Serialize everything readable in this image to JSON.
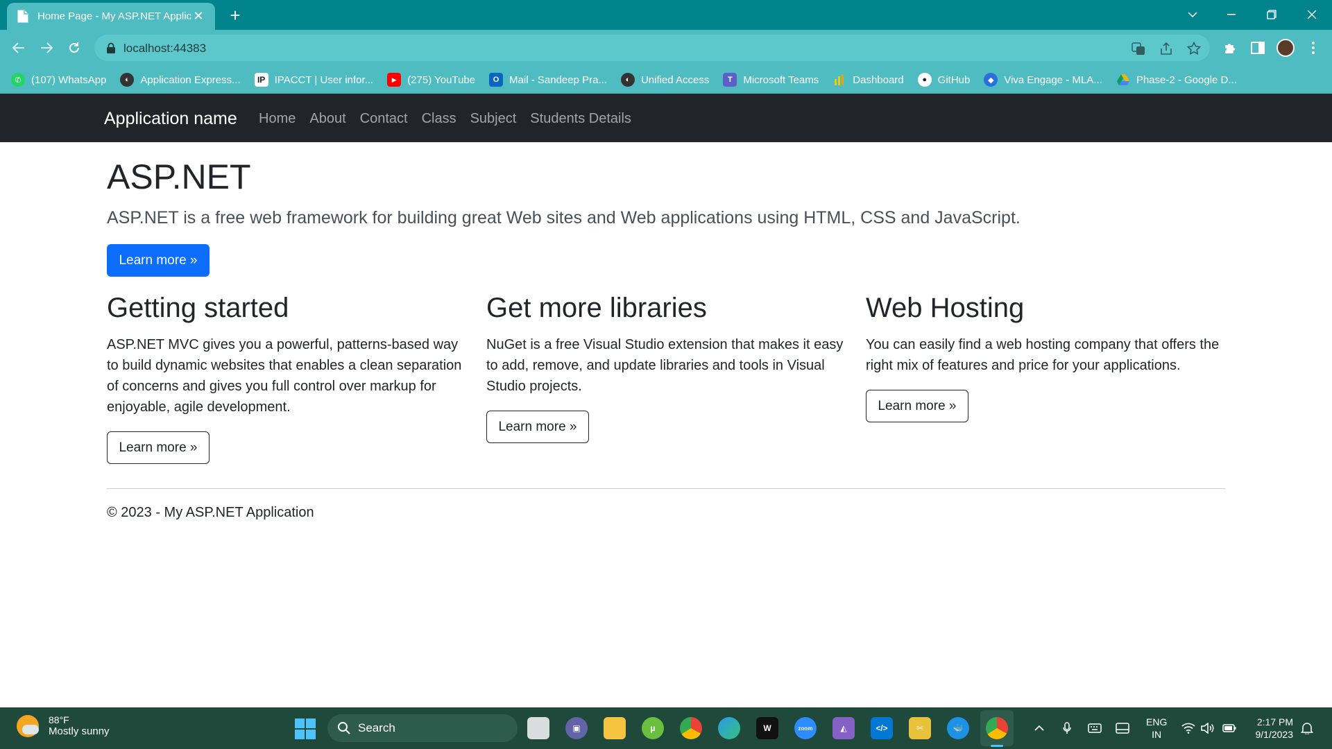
{
  "browser": {
    "tab_title": "Home Page - My ASP.NET Application",
    "url": "localhost:44383",
    "bookmarks": [
      {
        "label": "(107) WhatsApp",
        "icon": "whatsapp-icon",
        "color": "#25d366"
      },
      {
        "label": "Application Express...",
        "icon": "apex-icon",
        "color": "#333333"
      },
      {
        "label": "IPACCT | User infor...",
        "icon": "ipacct-icon",
        "color": "#222222"
      },
      {
        "label": "(275) YouTube",
        "icon": "youtube-icon",
        "color": "#ff0000"
      },
      {
        "label": "Mail - Sandeep Pra...",
        "icon": "outlook-icon",
        "color": "#0a64c2"
      },
      {
        "label": "Unified Access",
        "icon": "globe-icon",
        "color": "#333333"
      },
      {
        "label": "Microsoft Teams",
        "icon": "teams-icon",
        "color": "#5b5fc7"
      },
      {
        "label": "Dashboard",
        "icon": "dashboard-icon",
        "color": "#f2c811"
      },
      {
        "label": "GitHub",
        "icon": "github-icon",
        "color": "#1b1f23"
      },
      {
        "label": "Viva Engage - MLA...",
        "icon": "viva-engage-icon",
        "color": "#2c6fdb"
      },
      {
        "label": "Phase-2 - Google D...",
        "icon": "google-drive-icon",
        "color": "#f4b400"
      }
    ]
  },
  "navbar": {
    "brand": "Application name",
    "links": [
      "Home",
      "About",
      "Contact",
      "Class",
      "Subject",
      "Students Details"
    ]
  },
  "hero": {
    "title": "ASP.NET",
    "lead": "ASP.NET is a free web framework for building great Web sites and Web applications using HTML, CSS and JavaScript.",
    "button": "Learn more »"
  },
  "columns": [
    {
      "title": "Getting started",
      "text": "ASP.NET MVC gives you a powerful, patterns-based way to build dynamic websites that enables a clean separation of concerns and gives you full control over markup for enjoyable, agile development.",
      "button": "Learn more »"
    },
    {
      "title": "Get more libraries",
      "text": "NuGet is a free Visual Studio extension that makes it easy to add, remove, and update libraries and tools in Visual Studio projects.",
      "button": "Learn more »"
    },
    {
      "title": "Web Hosting",
      "text": "You can easily find a web hosting company that offers the right mix of features and price for your applications.",
      "button": "Learn more »"
    }
  ],
  "footer": {
    "text": "© 2023 - My ASP.NET Application"
  },
  "taskbar": {
    "weather_temp": "88°F",
    "weather_desc": "Mostly sunny",
    "search_label": "Search",
    "language_top": "ENG",
    "language_bottom": "IN",
    "time": "2:17 PM",
    "date": "9/1/2023"
  },
  "colors": {
    "chrome_teal": "#00838a",
    "chrome_light": "#4fbcc2",
    "navbar_dark": "#212529",
    "primary": "#0d6efd",
    "taskbar": "#1f4a3b"
  }
}
